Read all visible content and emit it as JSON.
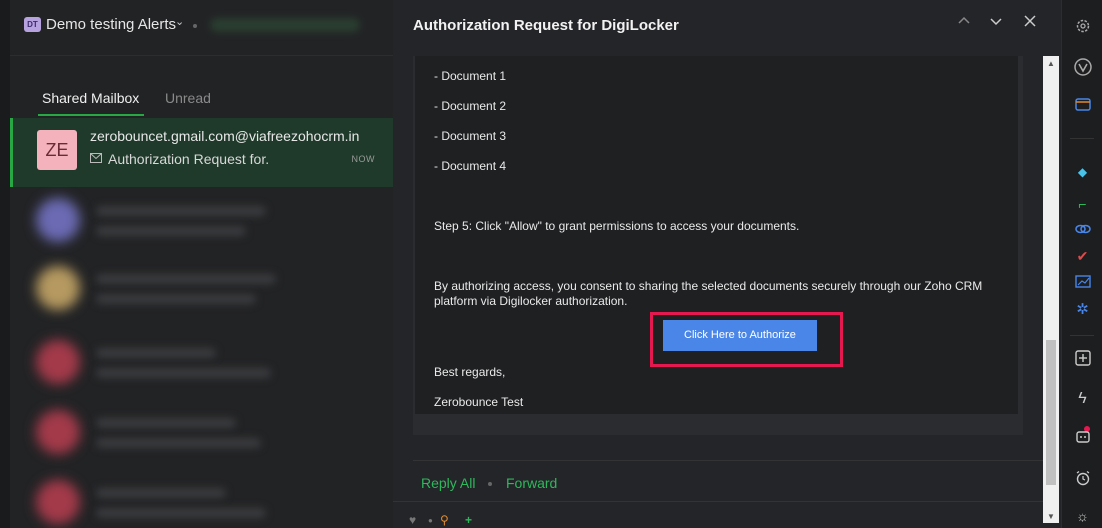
{
  "workspace": {
    "badge": "DT",
    "name": "Demo testing Alerts",
    "chevron": "⌄"
  },
  "tabs": [
    {
      "label": "Shared Mailbox"
    },
    {
      "label": "Unread"
    }
  ],
  "selected_mail": {
    "avatar": "ZE",
    "sender": "zerobouncet.gmail.com@viafreezohocrm.in",
    "subject": "Authorization Request for.",
    "time": "NOW",
    "mail_icon": "envelope-icon"
  },
  "reader": {
    "title": "Authorization Request for DigiLocker",
    "nav_icons": [
      "chevron-up-icon",
      "chevron-down-icon",
      "close-icon"
    ]
  },
  "mail_body": {
    "doc1": "- Document 1",
    "doc2": "- Document 2",
    "doc3": "- Document 3",
    "doc4": "- Document 4",
    "step5": "Step 5: Click \"Allow\" to grant permissions to access your documents.",
    "consent": "By authorizing access, you consent to sharing the selected documents securely through our Zoho CRM platform via Digilocker authorization.",
    "authorize_button": "Click Here to Authorize",
    "regards": "Best regards,",
    "signature": "Zerobounce Test"
  },
  "actions": {
    "reply_all": "Reply All",
    "forward": "Forward"
  },
  "right_bar_icons": [
    "settings-icon",
    "vivaldi-icon",
    "wallet-icon",
    "bird-icon",
    "boot-icon",
    "link-icon",
    "check-icon",
    "folder-chart-icon",
    "puzzle-icon",
    "add-panel-icon",
    "lightning-icon",
    "robot-icon",
    "alarm-icon",
    "weather-icon"
  ],
  "colors": {
    "accent": "#2eb85c",
    "highlight": "#e5194f",
    "button": "#4a86e8"
  }
}
